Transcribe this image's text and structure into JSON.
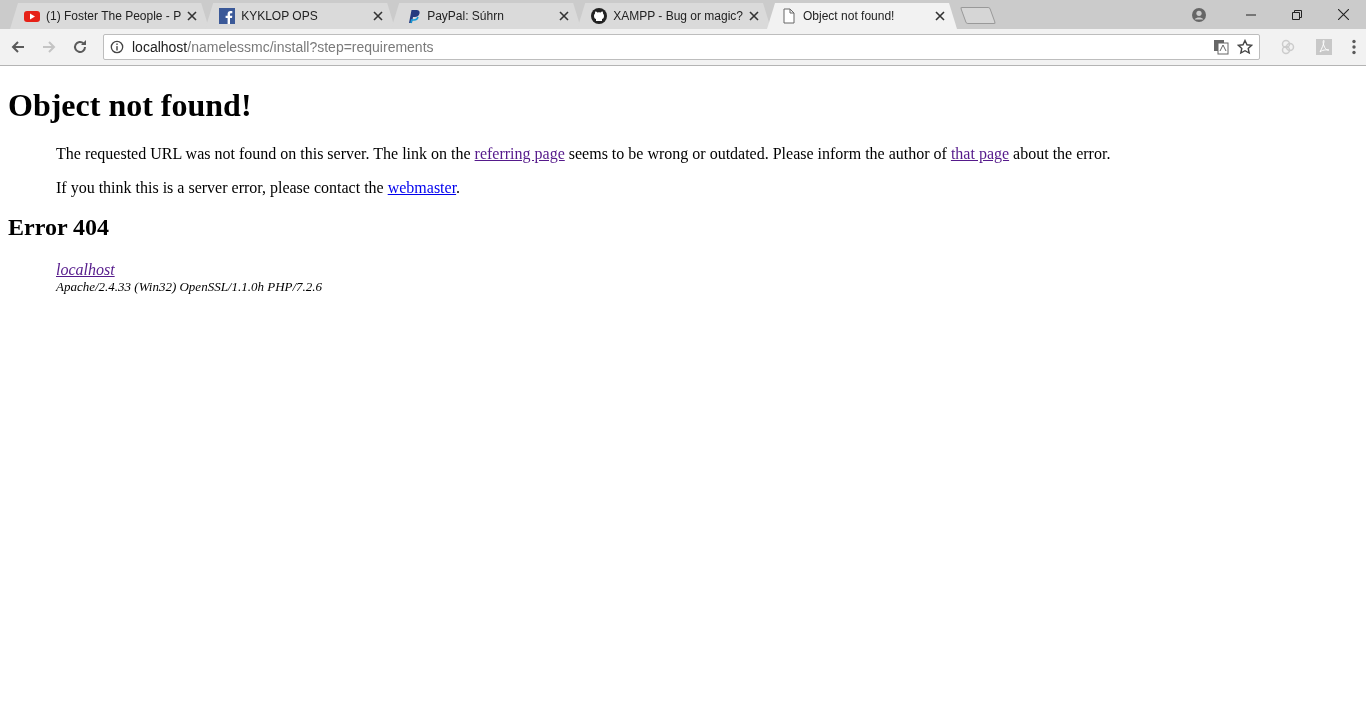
{
  "tabs": [
    {
      "title": "(1) Foster The People - P",
      "selected": false
    },
    {
      "title": "KYKLOP OPS",
      "selected": false
    },
    {
      "title": "PayPal: Súhrn",
      "selected": false
    },
    {
      "title": "XAMPP - Bug or magic?",
      "selected": false
    },
    {
      "title": "Object not found!",
      "selected": true
    }
  ],
  "address_bar": {
    "host": "localhost",
    "path": "/namelessmc/install?step=requirements"
  },
  "page": {
    "heading": "Object not found!",
    "paragraphs": [
      [
        {
          "kind": "text",
          "text": "The requested URL was not found on this server. The link on the "
        },
        {
          "kind": "link",
          "text": "referring page",
          "visited": true
        },
        {
          "kind": "text",
          "text": " seems to be wrong or outdated. Please inform the author of "
        },
        {
          "kind": "link",
          "text": "that page",
          "visited": true
        },
        {
          "kind": "text",
          "text": " about the error."
        }
      ],
      [
        {
          "kind": "text",
          "text": "If you think this is a server error, please contact the "
        },
        {
          "kind": "link",
          "text": "webmaster",
          "visited": false
        },
        {
          "kind": "text",
          "text": "."
        }
      ]
    ],
    "subheading": "Error 404",
    "address_link": {
      "text": "localhost",
      "visited": true
    },
    "server_signature": "Apache/2.4.33 (Win32) OpenSSL/1.1.0h PHP/7.2.6"
  }
}
